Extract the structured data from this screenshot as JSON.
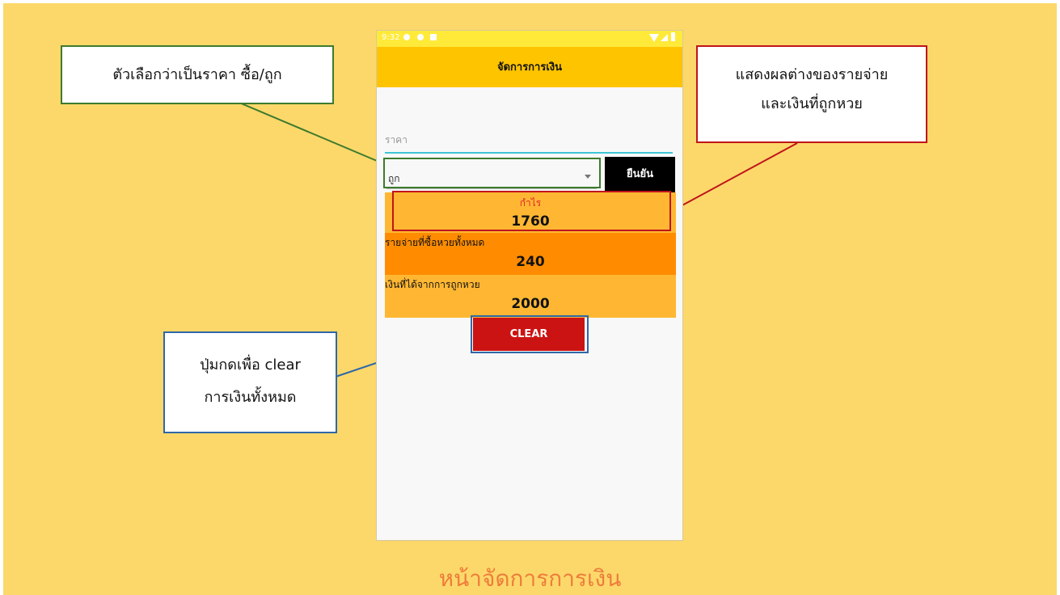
{
  "status_bar": {
    "time": "9:32"
  },
  "app": {
    "title": "จัดการการเงิน",
    "price_placeholder": "ราคา",
    "type_select": {
      "selected": "ถูก"
    },
    "confirm_button": "ยืนยัน",
    "profit": {
      "label": "กำไร",
      "value": "1760"
    },
    "expense": {
      "label": "รายจ่ายที่ซื้อหวยทั้งหมด",
      "value": "240"
    },
    "winning": {
      "label": "เงินที่ได้จากการถูกหวย",
      "value": "2000"
    },
    "clear_button": "CLEAR"
  },
  "callouts": {
    "select": "ตัวเลือกว่าเป็นราคา ซื้อ/ถูก",
    "summary_line1": "แสดงผลต่างของรายจ่าย",
    "summary_line2": "และเงินที่ถูกหวย",
    "clear_line1": "ปุ่มกดเพื่อ clear",
    "clear_line2": "การเงินทั้งหมด"
  },
  "caption": "หน้าจัดการการเงิน",
  "colors": {
    "background": "#fcd86a",
    "app_bar": "#ffc400",
    "status_bar": "#ffea3a",
    "profit_panel": "#ffb733",
    "expense_panel": "#ff8c00",
    "clear_button": "#cc1313",
    "callout_select_border": "#3d7a2e",
    "callout_summary_border": "#c0141b",
    "callout_clear_border": "#2f67a8"
  }
}
